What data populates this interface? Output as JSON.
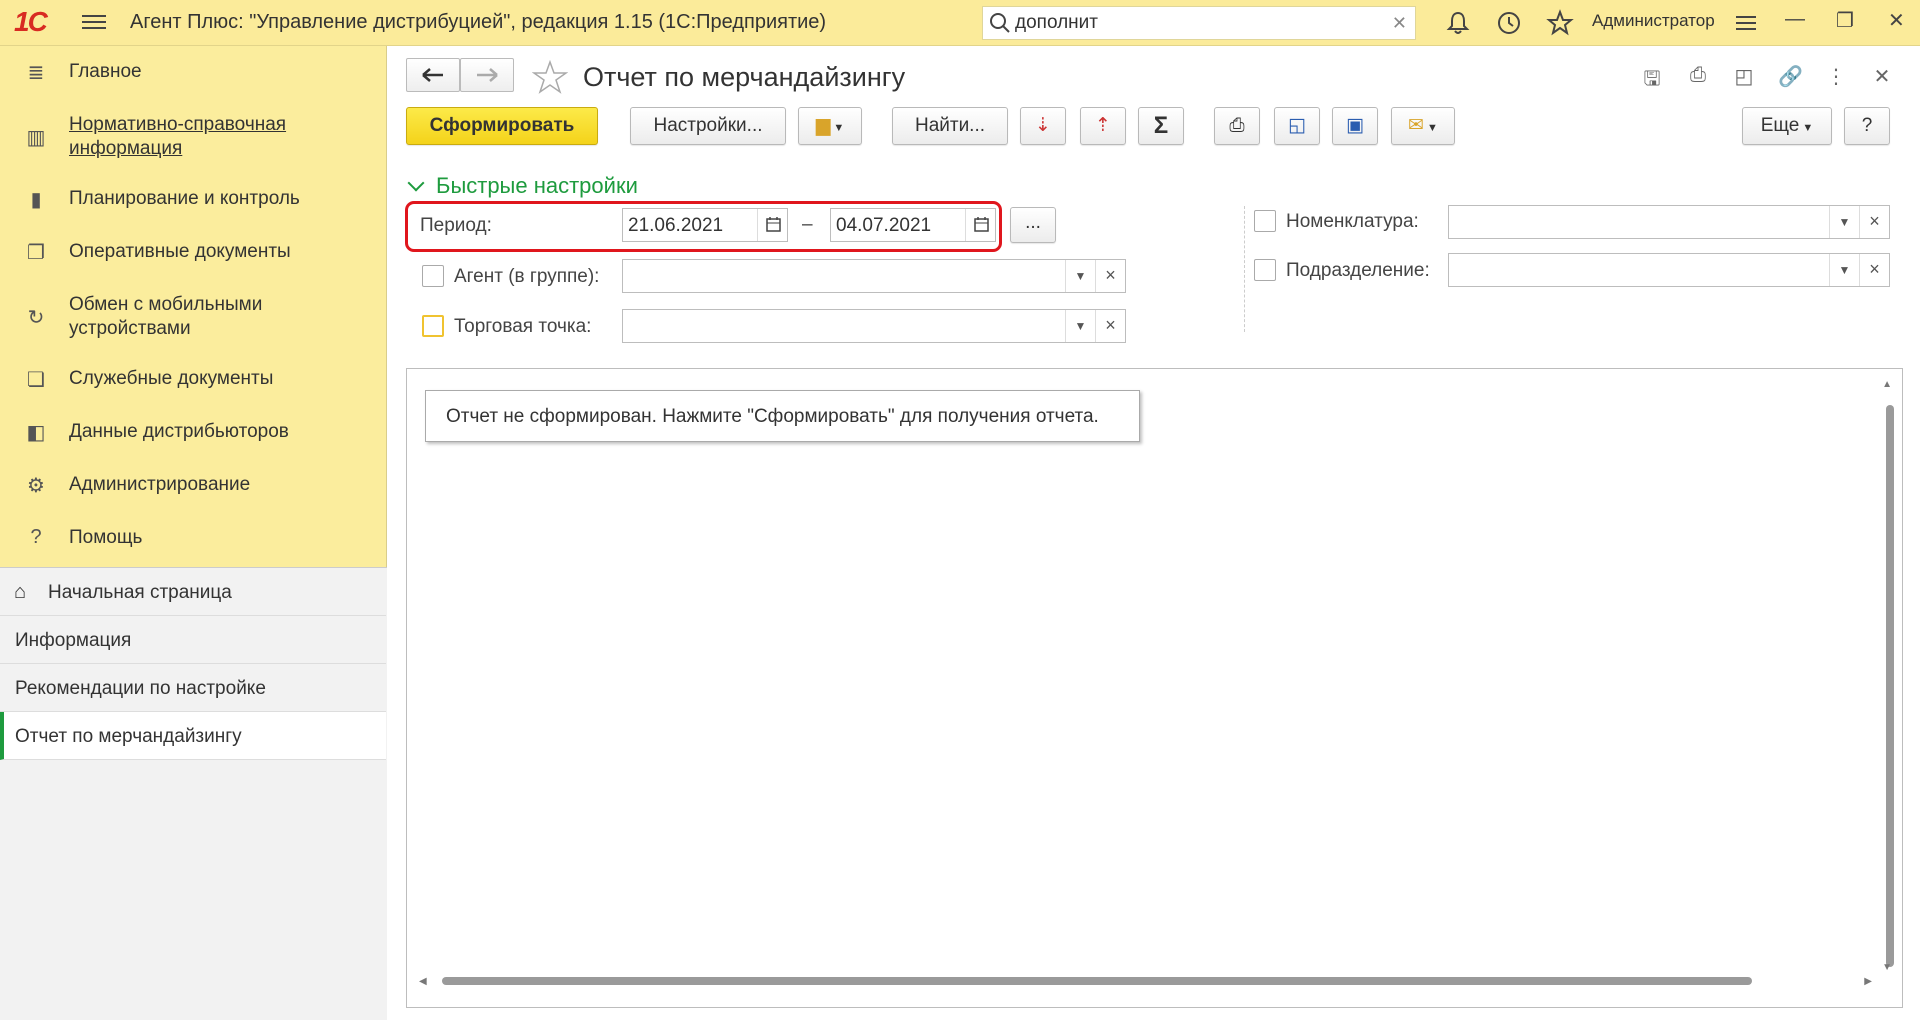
{
  "app": {
    "logo": "1С",
    "title": "Агент Плюс: \"Управление дистрибуцией\", редакция 1.15  (1С:Предприятие)",
    "search_value": "дополнит",
    "user": "Администратор"
  },
  "sidebar": {
    "items": [
      {
        "label": "Главное",
        "icon": "menu-lines-icon"
      },
      {
        "label": "Нормативно-справочная информация",
        "icon": "catalog-icon"
      },
      {
        "label": "Планирование и контроль",
        "icon": "bar-chart-icon"
      },
      {
        "label": "Оперативные документы",
        "icon": "documents-icon"
      },
      {
        "label": "Обмен с мобильными устройствами",
        "icon": "sync-icon"
      },
      {
        "label": "Служебные документы",
        "icon": "service-docs-icon"
      },
      {
        "label": "Данные дистрибьюторов",
        "icon": "distributors-icon"
      },
      {
        "label": "Администрирование",
        "icon": "gear-icon"
      },
      {
        "label": "Помощь",
        "icon": "help-icon"
      }
    ],
    "open_windows": [
      {
        "label": "Начальная страница",
        "icon": "home-icon"
      },
      {
        "label": "Информация"
      },
      {
        "label": "Рекомендации по настройке"
      },
      {
        "label": "Отчет по мерчандайзингу",
        "active": true
      }
    ]
  },
  "form": {
    "title": "Отчет по мерчандайзингу",
    "toolbar": {
      "generate": "Сформировать",
      "settings": "Настройки...",
      "find": "Найти...",
      "more": "Еще",
      "help": "?"
    },
    "quick_settings_title": "Быстрые настройки",
    "period": {
      "label": "Период:",
      "from": "21.06.2021",
      "dash": "–",
      "to": "04.07.2021",
      "ellipsis": "..."
    },
    "agent_label": "Агент (в группе):",
    "outlet_label": "Торговая точка:",
    "nomenclature_label": "Номенклатура:",
    "division_label": "Подразделение:",
    "report_message": "Отчет не сформирован. Нажмите \"Сформировать\" для получения отчета."
  },
  "colors": {
    "topbar": "#fbeb9a",
    "sidebar": "#fbed9d",
    "accent_green": "#1e9b3e",
    "primary_button": "#f4d31a",
    "highlight_red": "#e0161d"
  }
}
